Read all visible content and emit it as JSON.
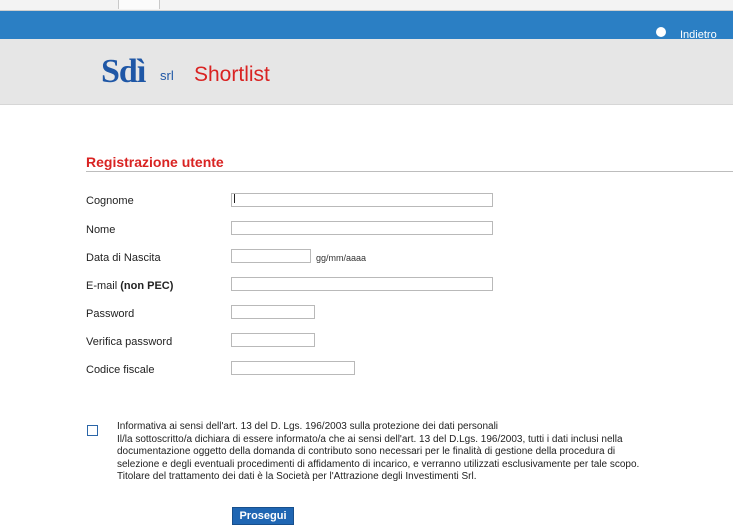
{
  "topbar": {
    "back_label": "Indietro",
    "accent": "#2b7fc4"
  },
  "header": {
    "logo_mark": "Sdì",
    "logo_suffix": "srl",
    "app_title": "Shortlist",
    "title_color": "#d92322"
  },
  "form": {
    "section_title": "Registrazione utente",
    "fields": [
      {
        "label": "Cognome",
        "value": ""
      },
      {
        "label": "Nome",
        "value": ""
      },
      {
        "label": "Data di Nascita",
        "value": "",
        "hint": "gg/mm/aaaa"
      },
      {
        "label": "E-mail",
        "label_bold": "(non PEC)",
        "value": ""
      },
      {
        "label": "Password",
        "value": ""
      },
      {
        "label": "Verifica password",
        "value": ""
      },
      {
        "label": "Codice fiscale",
        "value": ""
      }
    ]
  },
  "privacy": {
    "checked": false,
    "lines": [
      "Informativa ai sensi dell'art. 13 del D. Lgs. 196/2003 sulla protezione dei dati personali",
      "Il/la sottoscritto/a dichiara di essere informato/a che ai sensi dell'art. 13 del D.Lgs. 196/2003, tutti i dati inclusi nella",
      "documentazione oggetto della domanda di contributo sono necessari per le finalità di gestione della procedura di",
      "selezione e degli eventuali procedimenti di affidamento di incarico, e verranno utilizzati esclusivamente per tale scopo.",
      "Titolare del trattamento dei dati è la Società per l'Attrazione degli Investimenti Srl."
    ]
  },
  "actions": {
    "submit_label": "Prosegui"
  }
}
